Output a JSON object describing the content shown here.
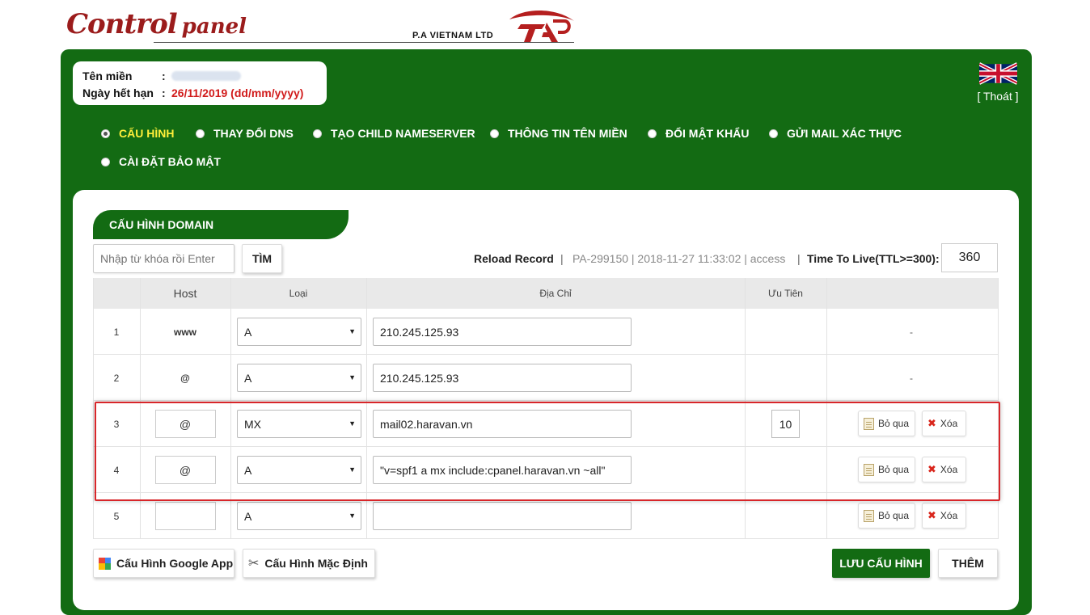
{
  "header": {
    "logo_main": "Control",
    "logo_sub": "panel",
    "company": "P.A VIETNAM LTD"
  },
  "info": {
    "domain_label": "Tên miền",
    "expiry_label": "Ngày hết hạn",
    "colon": ":",
    "expiry_value": "26/11/2019 (dd/mm/yyyy)"
  },
  "top_right": {
    "language_flag": "uk-flag-icon",
    "logout_label": "[ Thoát ]"
  },
  "nav": {
    "items": [
      {
        "label": "CẤU HÌNH",
        "active": true
      },
      {
        "label": "THAY ĐỔI DNS",
        "active": false
      },
      {
        "label": "TẠO CHILD NAMESERVER",
        "active": false
      },
      {
        "label": "THÔNG TIN TÊN MIỀN",
        "active": false
      },
      {
        "label": "ĐỔI MẬT KHẨU",
        "active": false
      },
      {
        "label": "GỬI MAIL XÁC THỰC",
        "active": false
      },
      {
        "label": "CÀI ĐẶT BẢO MẬT",
        "active": false
      }
    ]
  },
  "section": {
    "title": "CẤU HÌNH DOMAIN"
  },
  "toolbar": {
    "search_placeholder": "Nhập từ khóa rồi Enter",
    "find_label": "TÌM",
    "reload_label": "Reload Record",
    "separator": "|",
    "meta_text": "PA-299150 | 2018-11-27 11:33:02 | access",
    "ttl_label": "Time To Live(TTL>=300):",
    "ttl_value": "360"
  },
  "table": {
    "headers": {
      "index": "",
      "host": "Host",
      "type": "Loại",
      "address": "Địa Chỉ",
      "priority": "Ưu Tiên",
      "actions": ""
    },
    "rows": [
      {
        "index": "1",
        "host": "www",
        "type": "A",
        "address": "210.245.125.93",
        "priority": "",
        "actions": "-"
      },
      {
        "index": "2",
        "host": "@",
        "type": "A",
        "address": "210.245.125.93",
        "priority": "",
        "actions": "-"
      },
      {
        "index": "3",
        "host": "@",
        "type": "MX",
        "address": "mail02.haravan.vn",
        "priority": "10",
        "skip": "Bỏ qua",
        "delete": "Xóa"
      },
      {
        "index": "4",
        "host": "@",
        "type": "A",
        "address": "\"v=spf1 a mx include:cpanel.haravan.vn ~all\"",
        "priority": "",
        "skip": "Bỏ qua",
        "delete": "Xóa"
      },
      {
        "index": "5",
        "host": "",
        "type": "A",
        "address": "",
        "priority": "",
        "skip": "Bỏ qua",
        "delete": "Xóa"
      }
    ],
    "caret": "▼"
  },
  "bottom": {
    "google_label": "Cấu Hình Google App",
    "default_label": "Cấu Hình Mặc Định",
    "save_label": "LƯU CẤU HÌNH",
    "add_label": "THÊM"
  },
  "colors": {
    "brand_green": "#136b13",
    "active_nav": "#ffef3a",
    "expiry_red": "#d11c1c",
    "highlight_red": "#d8262a"
  }
}
